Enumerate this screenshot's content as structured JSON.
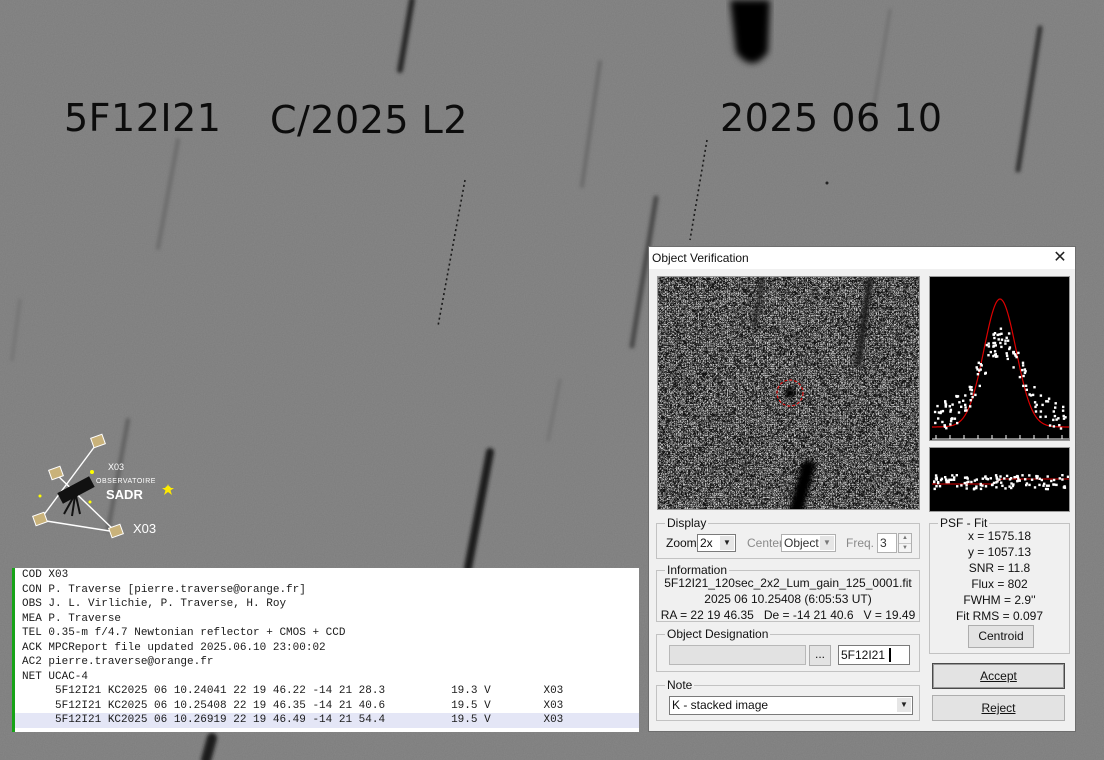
{
  "overlay": {
    "designation": "5F12I21",
    "comet": "C/2025 L2",
    "date": "2025 06 10"
  },
  "logo": {
    "code_top": "X03",
    "line1": "OBSERVATOIRE",
    "line2": "SADR",
    "code_bottom": "X03"
  },
  "report": {
    "lines": [
      "COD X03",
      "CON P. Traverse [pierre.traverse@orange.fr]",
      "OBS J. L. Virlichie, P. Traverse, H. Roy",
      "MEA P. Traverse",
      "TEL 0.35-m f/4.7 Newtonian reflector + CMOS + CCD",
      "ACK MPCReport file updated 2025.06.10 23:00:02",
      "AC2 pierre.traverse@orange.fr",
      "NET UCAC-4",
      "     5F12I21 KC2025 06 10.24041 22 19 46.22 -14 21 28.3          19.3 V        X03",
      "     5F12I21 KC2025 06 10.25408 22 19 46.35 -14 21 40.6          19.5 V        X03",
      "     5F12I21 KC2025 06 10.26919 22 19 46.49 -14 21 54.4          19.5 V        X03"
    ]
  },
  "dialog": {
    "title": "Object Verification",
    "display": {
      "group_label": "Display",
      "zoom_label": "Zoom",
      "zoom_value": "2x",
      "center_label": "Center",
      "center_value": "Object",
      "freq_label": "Freq.",
      "freq_value": "3"
    },
    "information": {
      "group_label": "Information",
      "filename": "5F12I21_120sec_2x2_Lum_gain_125_0001.fit",
      "datetime": "2025 06 10.25408 (6:05:53 UT)",
      "coords": "RA = 22 19 46.35   De = -14 21 40.6   V = 19.49"
    },
    "designation": {
      "group_label": "Object Designation",
      "browse_label": "...",
      "value": "5F12I21"
    },
    "note": {
      "group_label": "Note",
      "value": "K - stacked image"
    },
    "psf": {
      "group_label": "PSF - Fit",
      "x": "x = 1575.18",
      "y": "y = 1057.13",
      "snr": "SNR = 11.8",
      "flux": "Flux = 802",
      "fwhm": "FWHM = 2.9''",
      "fitrms": "Fit RMS = 0.097",
      "centroid_label": "Centroid"
    },
    "accept_label": "Accept",
    "reject_label": "Reject"
  }
}
